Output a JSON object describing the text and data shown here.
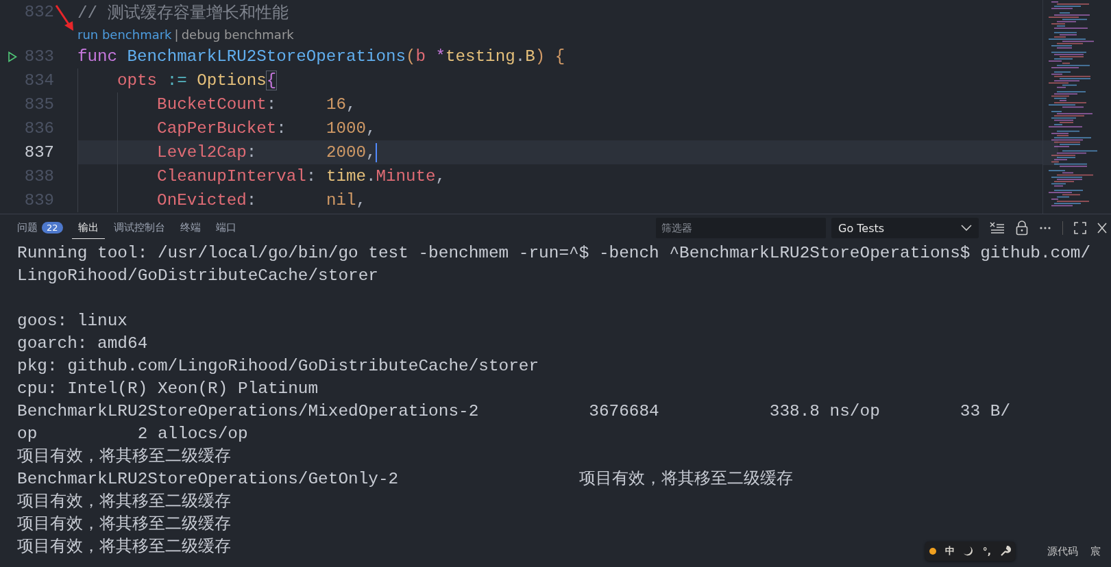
{
  "editor": {
    "lines": [
      {
        "kind": "code",
        "number": "832",
        "active": false,
        "cursor": false,
        "run": false,
        "tokens": [
          {
            "text": "// 测试缓存容量增长和性能",
            "color": "#7f848e"
          }
        ]
      },
      {
        "kind": "codelens",
        "separator": "|",
        "links": [
          {
            "text": "run benchmark",
            "hovered": true
          },
          {
            "text": "debug benchmark",
            "hovered": false
          }
        ]
      },
      {
        "kind": "code",
        "number": "833",
        "active": false,
        "cursor": false,
        "run": true,
        "tokens": [
          {
            "text": "func",
            "color": "#c678dd"
          },
          {
            "text": " BenchmarkLRU2StoreOperations",
            "color": "#61afef"
          },
          {
            "text": "(",
            "color": "#d19a66"
          },
          {
            "text": "b",
            "color": "#e06c75"
          },
          {
            "text": " *",
            "color": "#c678dd"
          },
          {
            "text": "testing",
            "color": "#e5c07b"
          },
          {
            "text": ".",
            "color": "#abb2bf"
          },
          {
            "text": "B",
            "color": "#e5c07b"
          },
          {
            "text": ")",
            "color": "#d19a66"
          },
          {
            "text": " {",
            "color": "#d19a66"
          }
        ]
      },
      {
        "kind": "code",
        "number": "834",
        "active": false,
        "cursor": false,
        "run": false,
        "tokens": [
          {
            "text": "    opts",
            "color": "#e06c75"
          },
          {
            "text": " :=",
            "color": "#56b6c2"
          },
          {
            "text": " Options",
            "color": "#e5c07b"
          },
          {
            "text": "{",
            "color": "#c678dd",
            "matched": true
          }
        ]
      },
      {
        "kind": "code",
        "number": "835",
        "active": false,
        "cursor": false,
        "run": false,
        "tokens": [
          {
            "text": "        BucketCount",
            "color": "#e06c75"
          },
          {
            "text": ":     ",
            "color": "#abb2bf"
          },
          {
            "text": "16",
            "color": "#d19a66"
          },
          {
            "text": ",",
            "color": "#abb2bf"
          }
        ]
      },
      {
        "kind": "code",
        "number": "836",
        "active": false,
        "cursor": false,
        "run": false,
        "tokens": [
          {
            "text": "        CapPerBucket",
            "color": "#e06c75"
          },
          {
            "text": ":    ",
            "color": "#abb2bf"
          },
          {
            "text": "1000",
            "color": "#d19a66"
          },
          {
            "text": ",",
            "color": "#abb2bf"
          }
        ]
      },
      {
        "kind": "code",
        "number": "837",
        "active": true,
        "cursor": true,
        "run": false,
        "tokens": [
          {
            "text": "        Level2Cap",
            "color": "#e06c75"
          },
          {
            "text": ":       ",
            "color": "#abb2bf"
          },
          {
            "text": "2000",
            "color": "#d19a66"
          },
          {
            "text": ",",
            "color": "#abb2bf"
          }
        ]
      },
      {
        "kind": "code",
        "number": "838",
        "active": false,
        "cursor": false,
        "run": false,
        "tokens": [
          {
            "text": "        CleanupInterval",
            "color": "#e06c75"
          },
          {
            "text": ": ",
            "color": "#abb2bf"
          },
          {
            "text": "time",
            "color": "#e5c07b"
          },
          {
            "text": ".",
            "color": "#abb2bf"
          },
          {
            "text": "Minute",
            "color": "#e06c75"
          },
          {
            "text": ",",
            "color": "#abb2bf"
          }
        ]
      },
      {
        "kind": "code",
        "number": "839",
        "active": false,
        "cursor": false,
        "run": false,
        "tokens": [
          {
            "text": "        OnEvicted",
            "color": "#e06c75"
          },
          {
            "text": ":       ",
            "color": "#abb2bf"
          },
          {
            "text": "nil",
            "color": "#d19a66"
          },
          {
            "text": ",",
            "color": "#abb2bf"
          }
        ]
      }
    ]
  },
  "panel": {
    "tabs": [
      {
        "label": "问题",
        "badge": "22",
        "selected": false
      },
      {
        "label": "输出",
        "selected": true
      },
      {
        "label": "调试控制台",
        "selected": false
      },
      {
        "label": "终端",
        "selected": false
      },
      {
        "label": "端口",
        "selected": false
      }
    ],
    "filter": {
      "placeholder": "筛选器"
    },
    "channel": {
      "value": "Go Tests"
    },
    "output": {
      "blocks": [
        [
          "Running tool: /usr/local/go/bin/go test -benchmem -run=^$ -bench ^BenchmarkLRU2StoreOperations$ github.com/",
          "LingoRihood/GoDistributeCache/storer"
        ],
        [
          "goos: linux",
          "goarch: amd64",
          "pkg: github.com/LingoRihood/GoDistributeCache/storer",
          "cpu: Intel(R) Xeon(R) Platinum",
          "BenchmarkLRU2StoreOperations/MixedOperations-2           3676684           338.8 ns/op        33 B/",
          "op          2 allocs/op",
          "项目有效，将其移至二级缓存",
          "BenchmarkLRU2StoreOperations/GetOnly-2                  项目有效，将其移至二级缓存",
          "项目有效，将其移至二级缓存",
          "项目有效，将其移至二级缓存",
          "项目有效，将其移至二级缓存"
        ]
      ]
    }
  },
  "ime_toolbar": {
    "mode": "中",
    "punctuation": "°,"
  },
  "status_bar": {
    "items": [
      "源代码",
      "宸"
    ]
  }
}
